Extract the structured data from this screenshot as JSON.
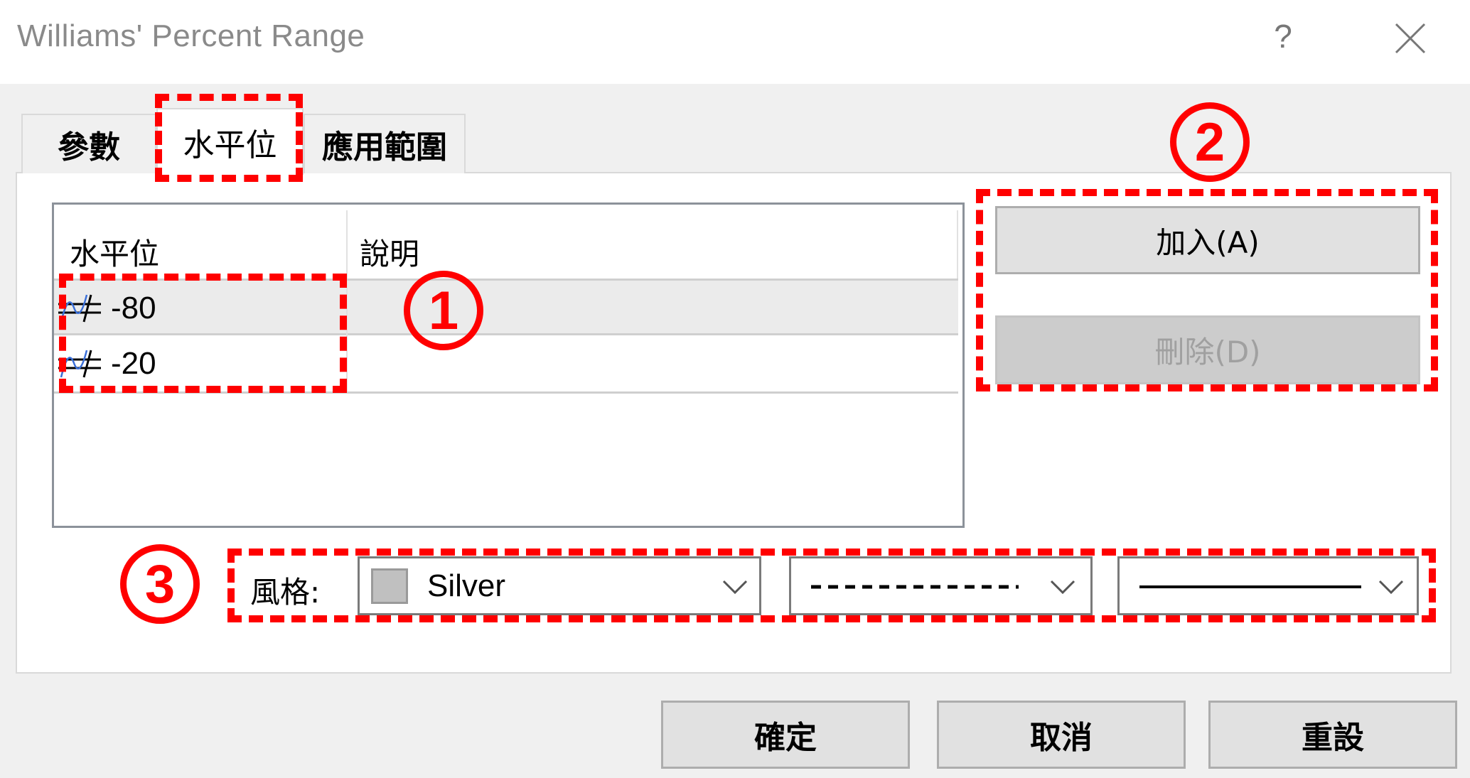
{
  "window": {
    "title": "Williams' Percent Range",
    "help_label": "?",
    "close_icon": "close-icon"
  },
  "tabs": [
    {
      "label": "參數",
      "active": false
    },
    {
      "label": "水平位",
      "active": true
    },
    {
      "label": "應用範圍",
      "active": false
    }
  ],
  "levels_table": {
    "columns": [
      "水平位",
      "說明"
    ],
    "rows": [
      {
        "icon": "level-line-icon",
        "level": "-80",
        "description": "",
        "selected": true
      },
      {
        "icon": "level-line-icon",
        "level": "-20",
        "description": "",
        "selected": false
      }
    ]
  },
  "side_buttons": {
    "add_label": "加入(A)",
    "delete_label": "刪除(D)",
    "delete_enabled": false
  },
  "style": {
    "label": "風格:",
    "color_name": "Silver",
    "color_hex": "#c0c0c0",
    "line_style": "dashed",
    "line_width": "solid-1"
  },
  "footer": {
    "ok_label": "確定",
    "cancel_label": "取消",
    "reset_label": "重設"
  },
  "annotations": {
    "marker_1": "1",
    "marker_2": "2",
    "marker_3": "3",
    "color": "#ff0000"
  }
}
